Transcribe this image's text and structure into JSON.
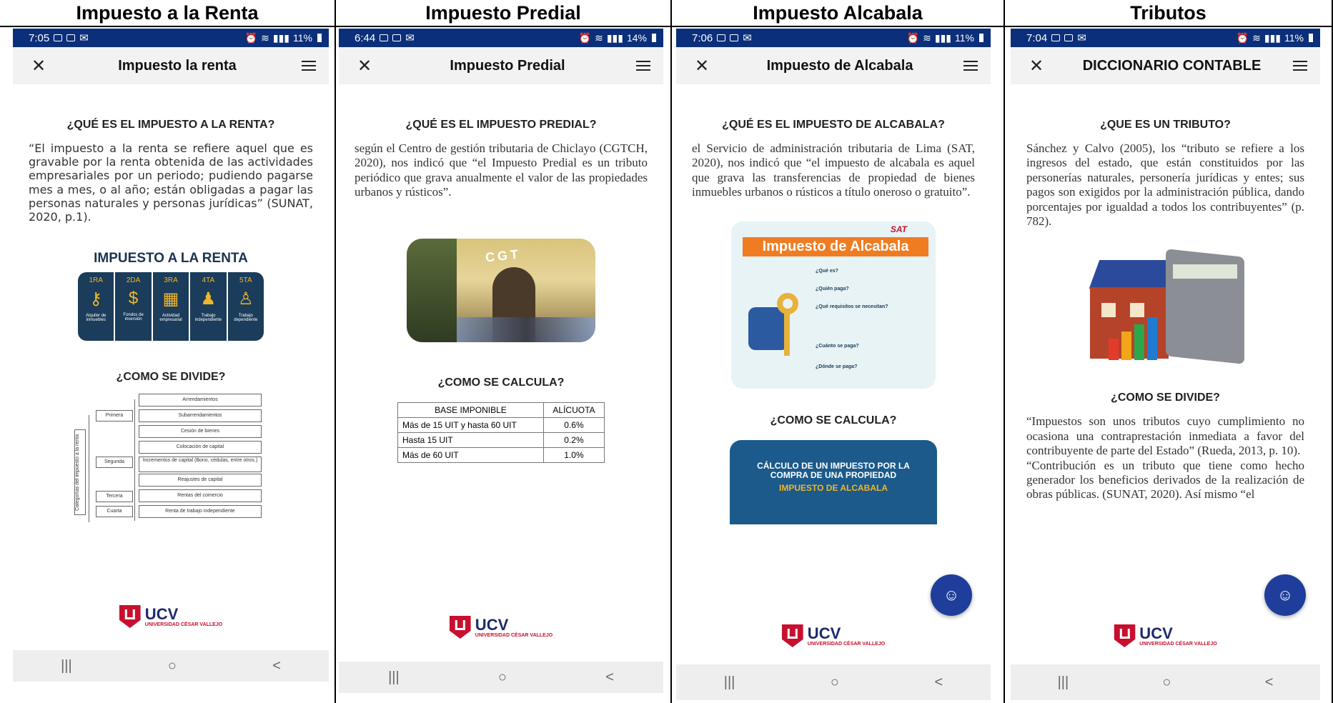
{
  "columns": [
    {
      "header": "Impuesto a la Renta",
      "status": {
        "time": "7:05",
        "battery": "11%"
      },
      "app_title": "Impuesto la renta",
      "question": "¿QUÉ ES EL IMPUESTO A LA RENTA?",
      "paragraph": "“El impuesto a la renta se refiere aquel que es gravable por la renta obtenida de las actividades empresariales por un periodo; pudiendo pagarse mes a mes, o al año; están obligadas a pagar las personas naturales y personas jurídicas” (SUNAT, 2020, p.1).",
      "banner": {
        "title": "IMPUESTO A LA RENTA",
        "items": [
          {
            "num": "1RA",
            "label": "Alquiler de inmuebles"
          },
          {
            "num": "2DA",
            "label": "Fondos de inversión"
          },
          {
            "num": "3RA",
            "label": "Actividad empresarial"
          },
          {
            "num": "4TA",
            "label": "Trabajo independiente"
          },
          {
            "num": "5TA",
            "label": "Trabajo dependiente"
          }
        ]
      },
      "question2": "¿COMO SE DIVIDE?",
      "diagram": {
        "root": "Categorías del impuesto a la renta",
        "groups": [
          {
            "name": "Primera",
            "items": [
              "Arrendamientos",
              "Subarrendamientos",
              "Cesión de bienes"
            ]
          },
          {
            "name": "Segunda",
            "items": [
              "Colocación de capital",
              "Incrementos de capital (Bono, cédulas, entre otros.)",
              "Reajustes de capital"
            ]
          },
          {
            "name": "Tercera",
            "items": [
              "Rentas del comercio"
            ]
          },
          {
            "name": "Cuarta",
            "items": [
              "Renta de trabajo independiente"
            ]
          }
        ]
      },
      "logo": {
        "name": "UCV",
        "sub": "UNIVERSIDAD CÉSAR VALLEJO"
      }
    },
    {
      "header": "Impuesto Predial",
      "status": {
        "time": "6:44",
        "battery": "14%"
      },
      "app_title": "Impuesto Predial",
      "question": "¿QUÉ ES EL IMPUESTO PREDIAL?",
      "paragraph": "según el Centro de gestión tributaria de Chiclayo (CGTCH, 2020), nos indicó que “el Impuesto Predial es un tributo periódico que grava anualmente el valor de las propiedades urbanos y rústicos”.",
      "photo_sign": "CGT",
      "question2": "¿COMO SE CALCULA?",
      "table": {
        "headers": [
          "BASE IMPONIBLE",
          "ALÍCUOTA"
        ],
        "rows": [
          [
            "Más de 15 UIT y hasta 60 UIT",
            "0.6%"
          ],
          [
            "Hasta 15 UIT",
            "0.2%"
          ],
          [
            "Más de 60 UIT",
            "1.0%"
          ]
        ]
      },
      "logo": {
        "name": "UCV",
        "sub": "UNIVERSIDAD CÉSAR VALLEJO"
      }
    },
    {
      "header": "Impuesto Alcabala",
      "status": {
        "time": "7:06",
        "battery": "11%"
      },
      "app_title": "Impuesto de Alcabala",
      "question": "¿QUÉ ES EL IMPUESTO DE ALCABALA?",
      "paragraph": "el Servicio de administración tributaria de Lima (SAT, 2020), nos indicó que “el impuesto de alcabala es aquel que grava las transferencias de propiedad de bienes inmuebles urbanos o rústicos a título oneroso o gratuito”.",
      "infographic": {
        "brand": "SAT",
        "title": "Impuesto de Alcabala",
        "items": [
          "¿Qué es?",
          "¿Quién paga?",
          "¿Qué requisitos se necesitan?",
          "¿Cuánto se paga?",
          "¿Dónde se paga?"
        ]
      },
      "question2": "¿COMO SE CALCULA?",
      "card2": {
        "title": "CÁLCULO DE UN IMPUESTO POR LA COMPRA DE UNA PROPIEDAD",
        "subtitle": "IMPUESTO DE ALCABALA"
      },
      "logo": {
        "name": "UCV",
        "sub": "UNIVERSIDAD CÉSAR VALLEJO"
      }
    },
    {
      "header": "Tributos",
      "status": {
        "time": "7:04",
        "battery": "11%"
      },
      "app_title": "DICCIONARIO CONTABLE",
      "question": "¿QUE ES UN TRIBUTO?",
      "paragraph": "Sánchez y Calvo (2005), los “tributo se refiere a los ingresos del estado, que están constituidos por las personerías naturales, personería jurídicas y entes; sus pagos son exigidos por la administración pública, dando porcentajes por igualdad a todos los contribuyentes” (p. 782).",
      "question2": "¿COMO SE DIVIDE?",
      "paragraph2": "“Impuestos son unos tributos cuyo cumplimiento no ocasiona una contraprestación inmediata a favor del contribuyente de parte del Estado” (Rueda, 2013, p. 10).",
      "paragraph3": "“Contribución es un tributo que tiene como hecho generador los beneficios derivados de la realización de obras públicas. (SUNAT, 2020). Así mismo “el",
      "logo": {
        "name": "UCV",
        "sub": "UNIVERSIDAD CÉSAR VALLEJO"
      }
    }
  ],
  "nav": {
    "recent": "|||",
    "home": "○",
    "back": "<"
  }
}
